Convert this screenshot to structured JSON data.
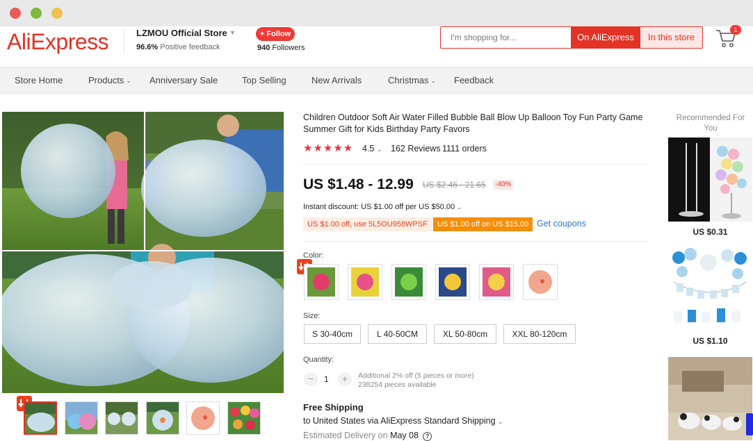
{
  "window": {
    "controls": [
      "close",
      "minimize",
      "zoom"
    ]
  },
  "header": {
    "logo": "AliExpress",
    "store_name": "LZMOU Official Store",
    "feedback_pct": "96.6%",
    "feedback_label": "Positive feedback",
    "follow_label": "+ Follow",
    "followers_count": "940",
    "followers_label": "Followers",
    "search_placeholder": "I'm shopping for...",
    "search_ali_label": "On AliExpress",
    "search_store_label": "In this store",
    "cart_count": "1"
  },
  "nav": {
    "items": [
      {
        "label": "Store Home",
        "has_caret": false
      },
      {
        "label": "Products",
        "has_caret": true
      },
      {
        "label": "Anniversary Sale",
        "has_caret": false
      },
      {
        "label": "Top Selling",
        "has_caret": false
      },
      {
        "label": "New Arrivals",
        "has_caret": false
      },
      {
        "label": "Christmas",
        "has_caret": true
      },
      {
        "label": "Feedback",
        "has_caret": false
      }
    ]
  },
  "product": {
    "title": "Children Outdoor Soft Air Water Filled Bubble Ball Blow Up Balloon Toy Fun Party Game Summer Gift for Kids Birthday Party Favors",
    "stars": "★★★★★",
    "rating": "4.5",
    "reviews": "162 Reviews",
    "orders": "1111 orders",
    "price": "US $1.48 - 12.99",
    "old_price": "US $2.46 - 21.65",
    "discount": "-40%",
    "instant_discount": "Instant discount: US $1.00 off per US $50.00",
    "coupon_code": "US $1.00 off, use 5L5OU958WPSF",
    "coupon_offer": "US $1.00 off on US $15.00",
    "get_coupons": "Get coupons",
    "color_label": "Color:",
    "size_label": "Size:",
    "sizes": [
      "S 30-40cm",
      "L 40-50CM",
      "XL 50-80cm",
      "XXL 80-120cm"
    ],
    "quantity_label": "Quantity:",
    "quantity": "1",
    "quantity_note_1": "Additional 2% off (5 pieces or more)",
    "quantity_note_2": "238254 pieces available",
    "shipping_title": "Free Shipping",
    "shipping_to": "to United States via AliExpress Standard Shipping",
    "delivery_prefix": "Estimated Delivery on",
    "delivery_date": "May 08",
    "help_glyph": "?"
  },
  "recommended": {
    "title": "Recommended For You",
    "items": [
      {
        "price": "US $0.31"
      },
      {
        "price": "US $1.10"
      }
    ]
  },
  "colors": {
    "brand": "#e43225",
    "coupon_orange": "#f68d0b",
    "link_blue": "#2f75c4",
    "star_red": "#f5303e"
  }
}
